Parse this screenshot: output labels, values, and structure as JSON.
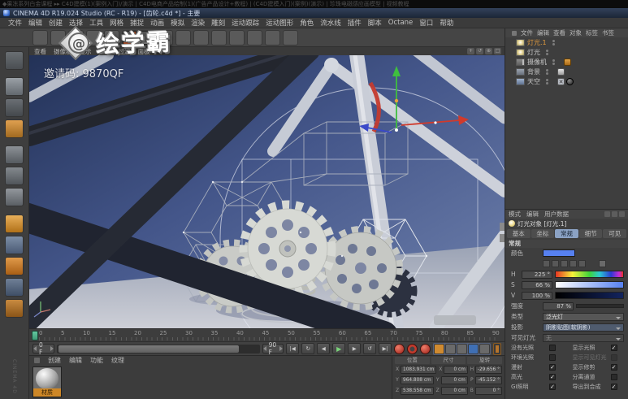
{
  "video_bar": {
    "title": "◆果冻系列白金课程 ▸▸ C4D建模(1)(案例入门)/演示 | C4D电商产品绘制(1)(广告产品设计+教程) | (C4D建模入门)(案例)(演示) | 珍珠电磁感应画模型 | 视频教程"
  },
  "window": {
    "title": "CINEMA 4D R19.024 Studio (RC - R19) - [齿轮.c4d *] - 主要"
  },
  "menu_bar": {
    "items": [
      "文件",
      "编辑",
      "创建",
      "选择",
      "工具",
      "网格",
      "捕捉",
      "动画",
      "模拟",
      "渲染",
      "雕刻",
      "运动跟踪",
      "运动图形",
      "角色",
      "流水线",
      "插件",
      "脚本",
      "Octane",
      "窗口",
      "帮助"
    ]
  },
  "toolbar": {
    "icons": [
      "undo",
      "redo",
      "coord-z",
      "coord-system",
      "render-view",
      "render-picture-viewer",
      "render-settings",
      "cube-primitive",
      "spline-pen",
      "subdivision-surface",
      "mograph-object",
      "deformer-object",
      "floor-object",
      "camera-object",
      "light-object"
    ]
  },
  "left_toolbar": {
    "icons": [
      "make-editable",
      "model-mode",
      "texture-mode",
      "workplane-mode",
      "points-mode",
      "edges-mode",
      "polygons-mode",
      "enable-axis",
      "viewport-solo",
      "enable-snap",
      "workplane-lock",
      "paint-tool"
    ]
  },
  "watermark": {
    "logo_text": "绘学霸",
    "logo_glyph": "@",
    "invite": "邀请码: 9870QF"
  },
  "viewport": {
    "menu": [
      "查看",
      "摄像机",
      "显示",
      "选项",
      "过滤",
      "面板"
    ],
    "corner_icons": [
      "+",
      "↺",
      "⊕",
      "□"
    ]
  },
  "object_manager": {
    "menu": [
      "文件",
      "编辑",
      "查看",
      "对象",
      "标签",
      "书签"
    ],
    "objects": [
      {
        "name": "灯光.1",
        "selected": true
      },
      {
        "name": "灯光",
        "selected": false
      },
      {
        "name": "摄像机",
        "selected": false
      },
      {
        "name": "背景",
        "selected": false
      },
      {
        "name": "天空",
        "selected": false
      }
    ]
  },
  "attributes": {
    "menu": [
      "模式",
      "编辑",
      "用户数据"
    ],
    "title": "灯光对象 [灯光.1]",
    "tabs": [
      "基本",
      "坐标",
      "常规",
      "细节",
      "可见"
    ],
    "active_tab": "常规",
    "section": "常规",
    "color_label": "颜色",
    "h_label": "H",
    "h_value": "225 °",
    "s_label": "S",
    "s_value": "66 %",
    "v_label": "V",
    "v_value": "100 %",
    "intensity_label": "强度",
    "intensity_value": "87 %",
    "type_label": "类型",
    "type_value": "泛光灯",
    "shadow_label": "投影",
    "shadow_value": "阴影贴图(软阴影)",
    "visible_label": "可见灯光",
    "visible_value": "无",
    "checkboxes": [
      {
        "label": "没有光照",
        "checked": false,
        "disabled": false
      },
      {
        "label": "显示光照",
        "checked": true,
        "disabled": false
      },
      {
        "label": "环境光照",
        "checked": false,
        "disabled": false
      },
      {
        "label": "显示可见灯光",
        "checked": false,
        "disabled": true
      },
      {
        "label": "漫射",
        "checked": true,
        "disabled": false
      },
      {
        "label": "显示修剪",
        "checked": true,
        "disabled": false
      },
      {
        "label": "高光",
        "checked": true,
        "disabled": false
      },
      {
        "label": "分离通道",
        "checked": false,
        "disabled": false
      },
      {
        "label": "GI照明",
        "checked": true,
        "disabled": false
      },
      {
        "label": "导出到合成",
        "checked": true,
        "disabled": false
      }
    ]
  },
  "timeline": {
    "ticks": [
      "0",
      "5",
      "10",
      "15",
      "20",
      "25",
      "30",
      "35",
      "40",
      "45",
      "50",
      "55",
      "60",
      "65",
      "70",
      "75",
      "80",
      "85",
      "90"
    ],
    "start_field": "0 F",
    "end_field": "90 F"
  },
  "transport": {
    "buttons": [
      {
        "name": "goto-start-button",
        "glyph": "|◀"
      },
      {
        "name": "play-backwards-button",
        "glyph": "↻"
      },
      {
        "name": "prev-frame-button",
        "glyph": "◀"
      },
      {
        "name": "play-button",
        "glyph": "▶"
      },
      {
        "name": "next-frame-button",
        "glyph": "▶"
      },
      {
        "name": "loop-button",
        "glyph": "↺"
      },
      {
        "name": "goto-end-button",
        "glyph": "▶|"
      }
    ]
  },
  "materials": {
    "menu": [
      "创建",
      "编辑",
      "功能",
      "纹理"
    ],
    "items": [
      {
        "name": "材质"
      }
    ]
  },
  "coordinates": {
    "headers": [
      "位置",
      "尺寸",
      "旋转"
    ],
    "pos_labels": [
      "X",
      "Y",
      "Z"
    ],
    "size_labels": [
      "X",
      "Y",
      "Z"
    ],
    "rot_labels": [
      "H",
      "P",
      "B"
    ],
    "position": [
      "1083.931 cm",
      "964.808 cm",
      "538.558 cm"
    ],
    "size": [
      "0 cm",
      "0 cm",
      "0 cm"
    ],
    "rotation": [
      "-29.656 °",
      "-45.152 °",
      "0 °"
    ]
  },
  "ui": {
    "check_glyph": "✓",
    "x_glyph": "✕",
    "dock_label": "CINEMA 4D",
    "swatch_style": "background:#5781f0",
    "intensity_fill_style": "width:87%"
  },
  "colors": {
    "light_color_swatch": "#5781f0",
    "selected_object_text": "#e09a3e",
    "active_tab": "#8ba2c4",
    "viewport_bg_top": "#233257",
    "viewport_floor": "#c9ccd4"
  }
}
